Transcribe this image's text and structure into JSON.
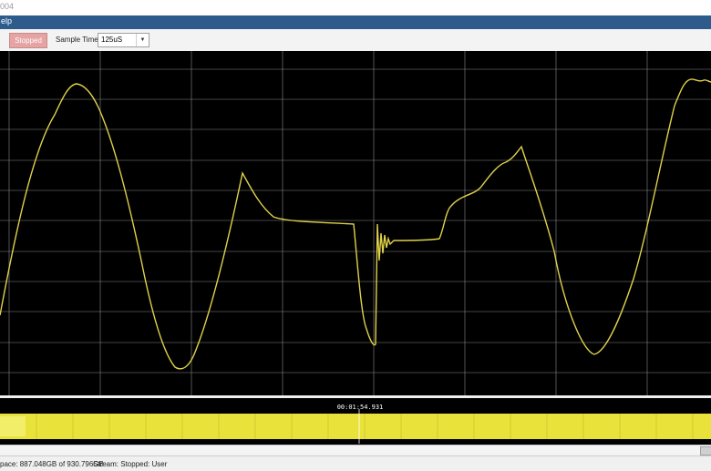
{
  "window": {
    "title_fragment": "004"
  },
  "menubar": {
    "item_help_fragment": "elp"
  },
  "toolbar": {
    "stopped_label": "Stopped",
    "sample_time_label": "Sample Time:",
    "sample_time_value": "125uS"
  },
  "scope": {
    "colors": {
      "background": "#000000",
      "grid": "#8a8a8a",
      "trace": "#e0d24a"
    }
  },
  "timeline": {
    "timestamp": "00:01:54.931",
    "colors": {
      "fill": "#e9e23a",
      "background": "#000000"
    }
  },
  "status": {
    "space": "pace: 887.048GB of 930.796GB",
    "stream": "Stream:  Stopped: User"
  }
}
